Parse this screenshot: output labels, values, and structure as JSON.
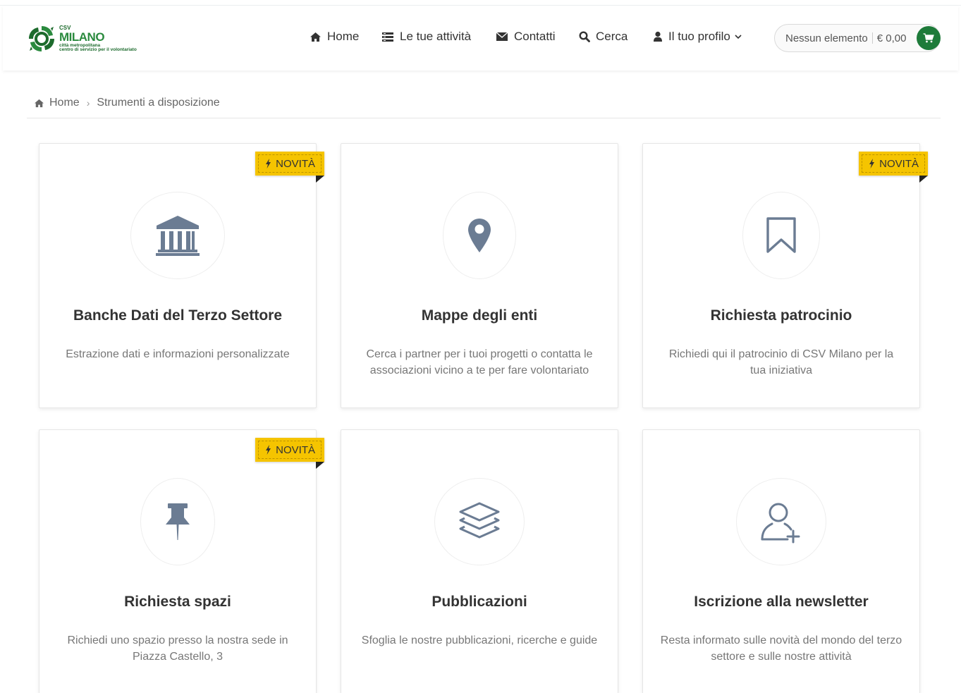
{
  "header": {
    "logo": {
      "small": "CSV",
      "big": "MILANO",
      "sub1": "città metropolitana",
      "sub2": "centro di servizio per il volontariato"
    },
    "nav": [
      {
        "label": "Home",
        "icon": "home-icon"
      },
      {
        "label": "Le tue attività",
        "icon": "list-icon"
      },
      {
        "label": "Contatti",
        "icon": "envelope-icon"
      },
      {
        "label": "Cerca",
        "icon": "search-icon"
      },
      {
        "label": "Il tuo profilo",
        "icon": "user-icon"
      }
    ],
    "cart": {
      "items_label": "Nessun elemento",
      "total": "€ 0,00",
      "icon": "cart-icon"
    }
  },
  "breadcrumb": {
    "home": "Home",
    "current": "Strumenti a disposizione"
  },
  "badge_label": "NOVITÀ",
  "cards": [
    {
      "title": "Banche Dati del Terzo Settore",
      "description": "Estrazione dati e informazioni personalizzate",
      "icon": "bank-icon",
      "badge": true
    },
    {
      "title": "Mappe degli enti",
      "description": "Cerca i partner per i tuoi progetti o contatta le associazioni vicino a te per fare volontariato",
      "icon": "map-marker-icon",
      "badge": false
    },
    {
      "title": "Richiesta patrocinio",
      "description": "Richiedi qui il patrocinio di CSV Milano per la tua iniziativa",
      "icon": "bookmark-icon",
      "badge": true
    },
    {
      "title": "Richiesta spazi",
      "description": "Richiedi uno spazio presso la nostra sede in Piazza Castello, 3",
      "icon": "pushpin-icon",
      "badge": true
    },
    {
      "title": "Pubblicazioni",
      "description": "Sfoglia le nostre pubblicazioni, ricerche e guide",
      "icon": "layers-icon",
      "badge": false
    },
    {
      "title": "Iscrizione alla newsletter",
      "description": "Resta informato sulle novità del mondo del terzo settore e sulle nostre attività",
      "icon": "user-add-icon",
      "badge": false
    }
  ],
  "colors": {
    "brand_green": "#1e7b3a",
    "badge_yellow": "#f5c400",
    "icon_gray": "#6b7c93"
  }
}
